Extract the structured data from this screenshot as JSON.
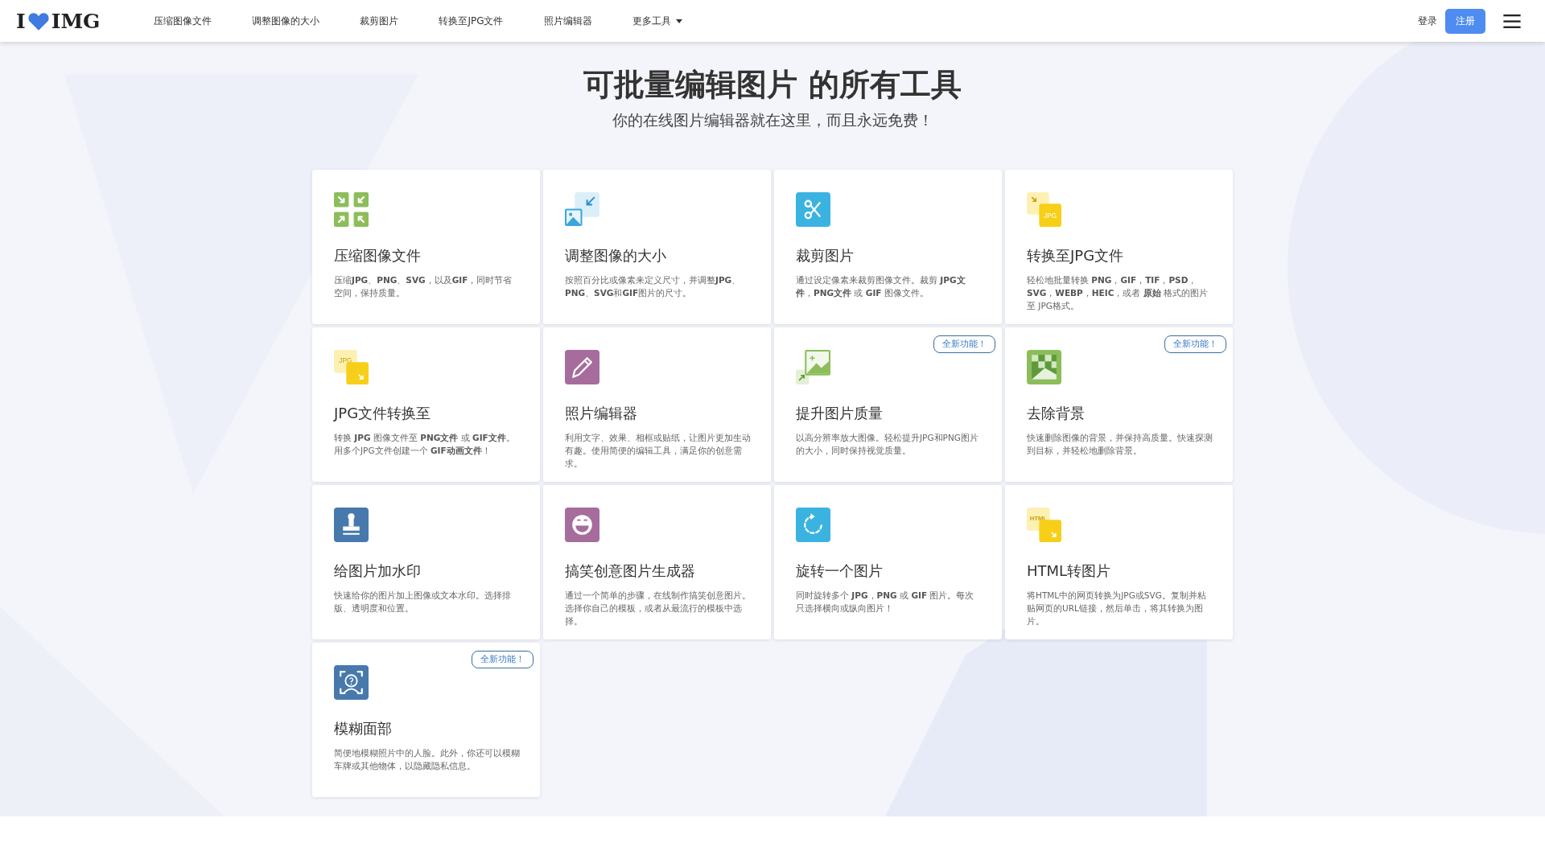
{
  "header": {
    "logo": {
      "left": "I",
      "right": "IMG"
    },
    "nav": [
      {
        "label": "压缩图像文件",
        "dropdown": false
      },
      {
        "label": "调整图像的大小",
        "dropdown": false
      },
      {
        "label": "裁剪图片",
        "dropdown": false
      },
      {
        "label": "转换至JPG文件",
        "dropdown": false
      },
      {
        "label": "照片编辑器",
        "dropdown": false
      },
      {
        "label": "更多工具",
        "dropdown": true
      }
    ],
    "login": "登录",
    "signup": "注册"
  },
  "hero": {
    "title": "可批量编辑图片 的所有工具",
    "subtitle": "你的在线图片编辑器就在这里，而且永远免费！"
  },
  "tools": [
    {
      "title": "压缩图像文件",
      "description": "压缩**JPG**、**PNG**、**SVG**，以及**GIF**，同时节省空间，保持质量。"
    },
    {
      "title": "调整图像的大小",
      "description": "按照百分比或像素来定义尺寸，并调整**JPG**、**PNG**、**SVG**和**GIF**图片的尺寸。"
    },
    {
      "title": "裁剪图片",
      "description": "通过设定像素来裁剪图像文件。裁剪 **JPG文件**，**PNG文件** 或 **GIF** 图像文件。"
    },
    {
      "title": "转换至JPG文件",
      "icon_label": "JPG",
      "description": "轻松地批量转换 **PNG**，**GIF**，**TIF**，**PSD**，**SVG**，**WEBP**，**HEIC**，或者 **原始** 格式的图片至 JPG格式。"
    },
    {
      "title": "JPG文件转换至",
      "icon_label": "JPG",
      "description": "转换 **JPG** 图像文件至 **PNG文件** 或 **GIF文件**。用多个JPG文件创建一个 **GIF动画文件**！"
    },
    {
      "title": "照片编辑器",
      "description": "利用文字、效果、相框或贴纸，让图片更加生动有趣。使用简便的编辑工具，满足你的创意需求。"
    },
    {
      "title": "提升图片质量",
      "description": "以高分辨率放大图像。轻松提升JPG和PNG图片的大小，同时保持视觉质量。",
      "badge": "全新功能！"
    },
    {
      "title": "去除背景",
      "description": "快速删除图像的背景，并保持高质量。快速探测到目标，并轻松地删除背景。",
      "badge": "全新功能！"
    },
    {
      "title": "给图片加水印",
      "description": "快速给你的图片加上图像或文本水印。选择排版、透明度和位置。"
    },
    {
      "title": "搞笑创意图片生成器",
      "description": "通过一个简单的步骤，在线制作搞笑创意图片。选择你自己的模板，或者从最流行的模板中选择。"
    },
    {
      "title": "旋转一个图片",
      "description": "同时旋转多个 **JPG**，**PNG** 或 **GIF** 图片。每次只选择横向或纵向图片！"
    },
    {
      "title": "HTML转图片",
      "icon_label": "HTML",
      "description": "将HTML中的网页转换为JPG或SVG。复制并粘贴网页的URL链接，然后单击，将其转换为图片。"
    },
    {
      "title": "模糊面部",
      "description": "简便地模糊照片中的人脸。此外，你还可以模糊车牌或其他物体，以隐藏隐私信息。",
      "badge": "全新功能！"
    }
  ]
}
